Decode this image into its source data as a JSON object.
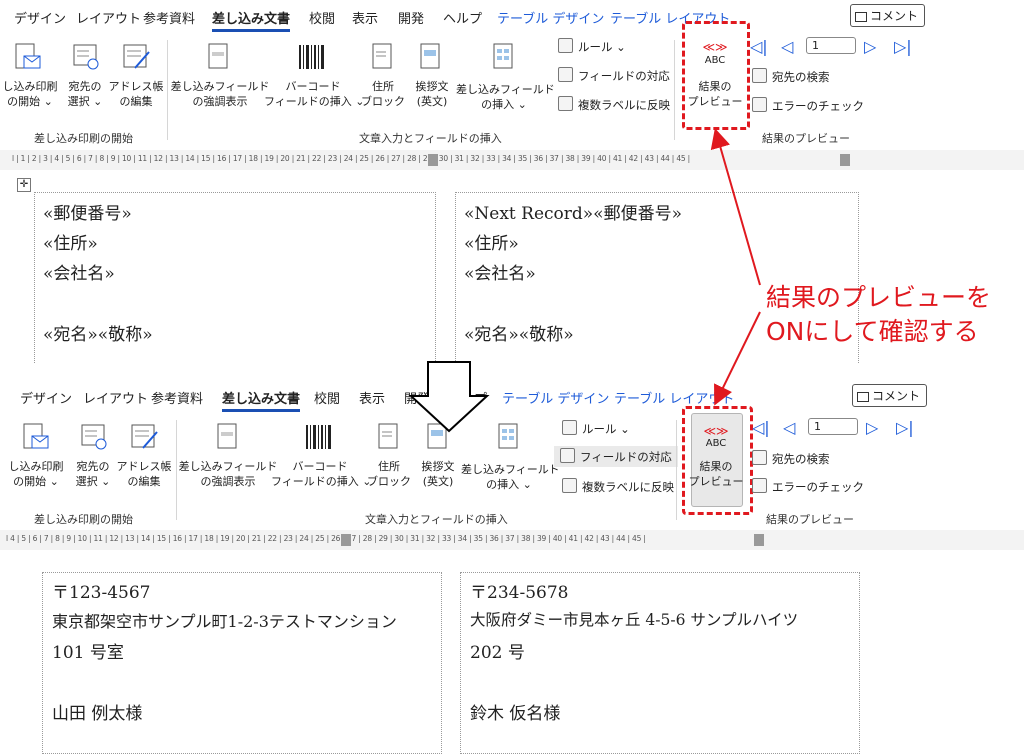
{
  "ribbon_top": {
    "tabs": [
      "デザイン",
      "レイアウト",
      "参考資料",
      "差し込み文書",
      "校閲",
      "表示",
      "開発",
      "ヘルプ",
      "テーブル デザイン",
      "テーブル レイアウト"
    ],
    "comment_label": "コメント",
    "buttons": {
      "start_merge": "し込み印刷\nの開始 ⌄",
      "select_recipients": "宛先の\n選択 ⌄",
      "edit_list": "アドレス帳\nの編集",
      "highlight_fields": "差し込みフィールド\nの強調表示",
      "barcode": "バーコード\nフィールドの挿入 ⌄",
      "address_block": "住所\nブロック",
      "greeting": "挨拶文\n(英文)",
      "insert_field": "差し込みフィールド\nの挿入 ⌄",
      "rules": "ルール ⌄",
      "match_fields": "フィールドの対応",
      "update_labels": "複数ラベルに反映",
      "preview_abc": "ABC",
      "preview": "結果の\nプレビュー",
      "find_recipient": "宛先の検索",
      "check_errors": "エラーのチェック",
      "record": "1"
    },
    "groups": {
      "start": "差し込み印刷の開始",
      "write": "文章入力とフィールドの挿入",
      "preview": "結果のプレビュー"
    }
  },
  "ruler_top": "l | 1 | 2 | 3 | 4 | 5 | 6 | 7 | 8 | 9 | 10 | 11 | 12 | 13 | 14 | 15 | 16 | 17 | 18 | 19 | 20 | 21 | 22 | 23 | 24 | 25 | 26 | 27 | 28 | 29 | 30 | 31 | 32 | 33 | 34 | 35 | 36 | 37 | 38 | 39 | 40 | 41 | 42 | 43 | 44 | 45 |",
  "ruler_bottom": "l 4 | 5 | 6 | 7 | 8 | 9 | 10 | 11 | 12 | 13 | 14 | 15 | 16 | 17 | 18 | 19 | 20 | 21 | 22 | 23 | 24 | 25 | 26 | 27 | 28 | 29 | 30 | 31 | 32 | 33 | 34 | 35 | 36 | 37 | 38 | 39 | 40 | 41 | 42 | 43 | 44 | 45 |",
  "doc_top": {
    "left": [
      "«郵便番号»",
      "«住所»",
      "«会社名»",
      "«宛名»«敬称»"
    ],
    "right": [
      "«Next Record»«郵便番号»",
      "«住所»",
      "«会社名»",
      "«宛名»«敬称»"
    ]
  },
  "annotation": [
    "結果のプレビューを",
    "ONにして確認する"
  ],
  "doc_bottom": {
    "left": [
      "〒123-4567",
      "東京都架空市サンプル町1-2-3テストマンション",
      "101 号室",
      "山田  例太様"
    ],
    "right": [
      "〒234-5678",
      "大阪府ダミー市見本ヶ丘  4-5-6  サンプルハイツ",
      "202 号",
      "鈴木  仮名様"
    ]
  },
  "colors": {
    "accent_red": "#e0191f",
    "tab_blue": "#1e5bd8"
  }
}
